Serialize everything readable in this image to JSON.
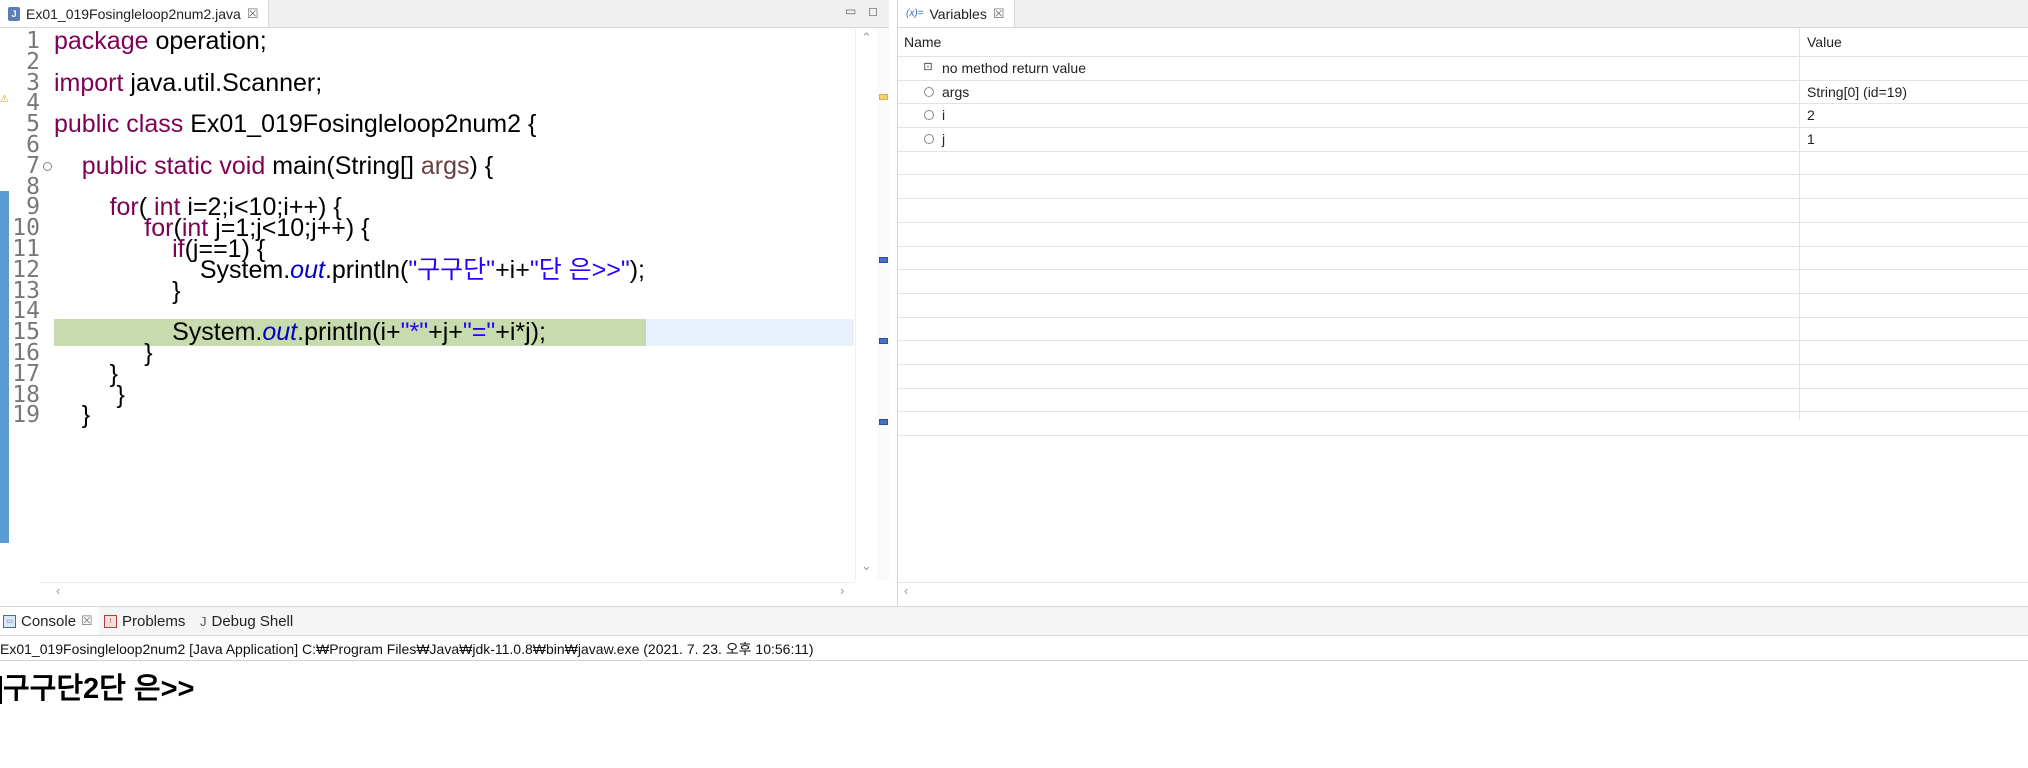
{
  "editor": {
    "tab_label": "Ex01_019Fosingleloop2num2.java",
    "close_glyph": "☒",
    "minimize_glyph": "▭",
    "maximize_glyph": "◻",
    "lines": [
      {
        "n": "1",
        "code": "package operation;"
      },
      {
        "n": "2",
        "code": ""
      },
      {
        "n": "3",
        "code": "import java.util.Scanner;"
      },
      {
        "n": "4",
        "code": ""
      },
      {
        "n": "5",
        "code": "public class Ex01_019Fosingleloop2num2 {"
      },
      {
        "n": "6",
        "code": ""
      },
      {
        "n": "7",
        "code": "    public static void main(String[] args) {"
      },
      {
        "n": "8",
        "code": ""
      },
      {
        "n": "9",
        "code": "        for( int i=2;i<10;i++) {"
      },
      {
        "n": "10",
        "code": "             for(int j=1;j<10;j++) {"
      },
      {
        "n": "11",
        "code": "                 if(j==1) {"
      },
      {
        "n": "12",
        "code": "                     System.out.println(\"구구단\"+i+\"단 은>>\");"
      },
      {
        "n": "13",
        "code": "                 }"
      },
      {
        "n": "14",
        "code": ""
      },
      {
        "n": "15",
        "code": "                 System.out.println(i+\"*\"+j+\"=\"+i*j);"
      },
      {
        "n": "16",
        "code": "             }"
      },
      {
        "n": "17",
        "code": "        }"
      },
      {
        "n": "18",
        "code": "         }"
      },
      {
        "n": "19",
        "code": "    }"
      }
    ],
    "current_line": "15"
  },
  "variables": {
    "tab_label": "Variables",
    "tab_icon": "(x)=",
    "close_glyph": "☒",
    "columns": {
      "name": "Name",
      "value": "Value"
    },
    "rows": [
      {
        "name": "no method return value",
        "value": "",
        "icon": "return-icon"
      },
      {
        "name": "args",
        "value": "String[0]  (id=19)",
        "icon": "local-var-icon"
      },
      {
        "name": "i",
        "value": "2",
        "icon": "local-var-icon"
      },
      {
        "name": "j",
        "value": "1",
        "icon": "local-var-icon"
      }
    ]
  },
  "console": {
    "tabs": [
      {
        "label": "Console",
        "icon": "console-icon"
      },
      {
        "label": "Problems",
        "icon": "problems-icon"
      },
      {
        "label": "Debug Shell",
        "icon": "debug-shell-icon"
      }
    ],
    "close_glyph": "☒",
    "process_label": "Ex01_019Fosingleloop2num2 [Java Application] C:₩Program Files₩Java₩jdk-11.0.8₩bin₩javaw.exe  (2021. 7. 23. 오후 10:56:11)",
    "output": "구구단2단 은>>"
  }
}
